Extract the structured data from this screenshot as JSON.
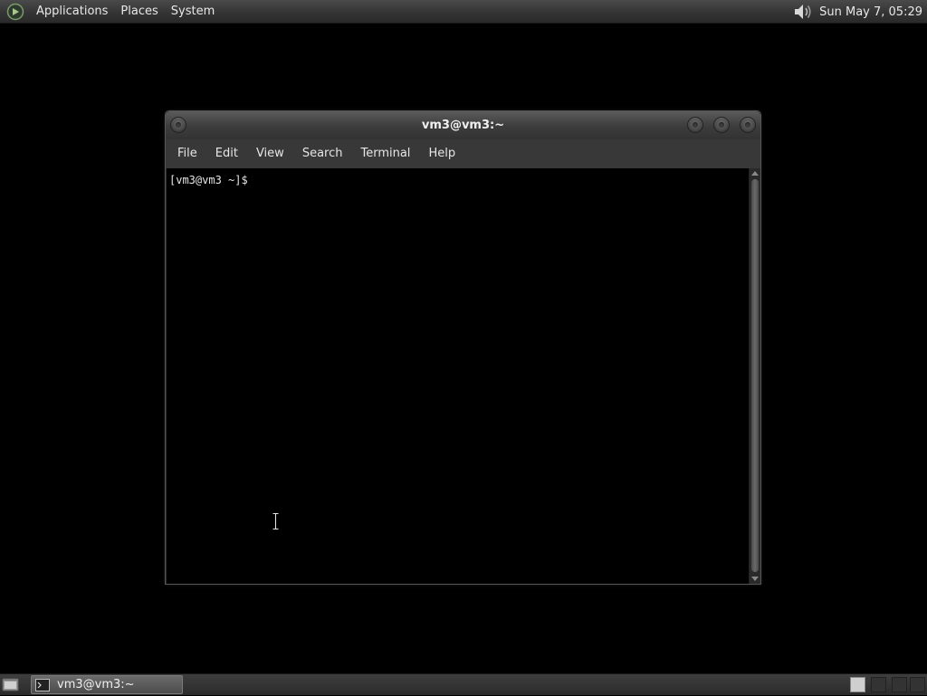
{
  "top_panel": {
    "menus": [
      "Applications",
      "Places",
      "System"
    ],
    "clock": "Sun May  7, 05:29"
  },
  "window": {
    "title": "vm3@vm3:~",
    "menu": [
      "File",
      "Edit",
      "View",
      "Search",
      "Terminal",
      "Help"
    ],
    "prompt": "[vm3@vm3 ~]$"
  },
  "bottom_panel": {
    "task_label": "vm3@vm3:~"
  },
  "colors": {
    "desktop_bg": "#000000",
    "panel_bg": "#333333",
    "text": "#e8e8e8"
  },
  "icons": {
    "menu_logo": "distro-logo-icon",
    "volume": "volume-icon",
    "show_desktop": "show-desktop-icon",
    "terminal": "terminal-icon"
  }
}
